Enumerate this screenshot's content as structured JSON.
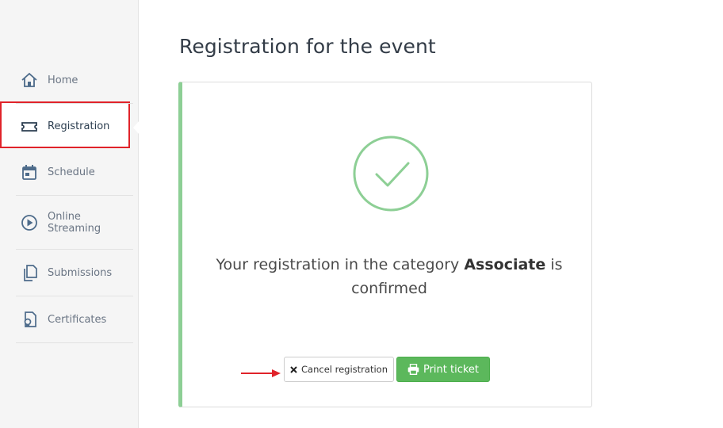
{
  "sidebar": {
    "items": [
      {
        "label": "Home",
        "icon": "home-icon"
      },
      {
        "label": "Registration",
        "icon": "ticket-icon",
        "active": true
      },
      {
        "label": "Schedule",
        "icon": "calendar-icon"
      },
      {
        "label": "Online Streaming",
        "icon": "play-circle-icon"
      },
      {
        "label": "Submissions",
        "icon": "copy-files-icon"
      },
      {
        "label": "Certificates",
        "icon": "certificate-icon"
      }
    ]
  },
  "main": {
    "title": "Registration for the event",
    "confirmation": {
      "text_before": "Your registration in the category",
      "category": "Associate",
      "text_after": "is confirmed",
      "icon": "checkmark-circle-icon"
    },
    "buttons": {
      "cancel_label": "Cancel registration",
      "print_label": "Print ticket"
    }
  },
  "colors": {
    "accent_green": "#5cb85c",
    "card_border_green": "#8dcf95",
    "highlight_red": "#e0232a",
    "nav_icon": "#4d6b8a"
  }
}
